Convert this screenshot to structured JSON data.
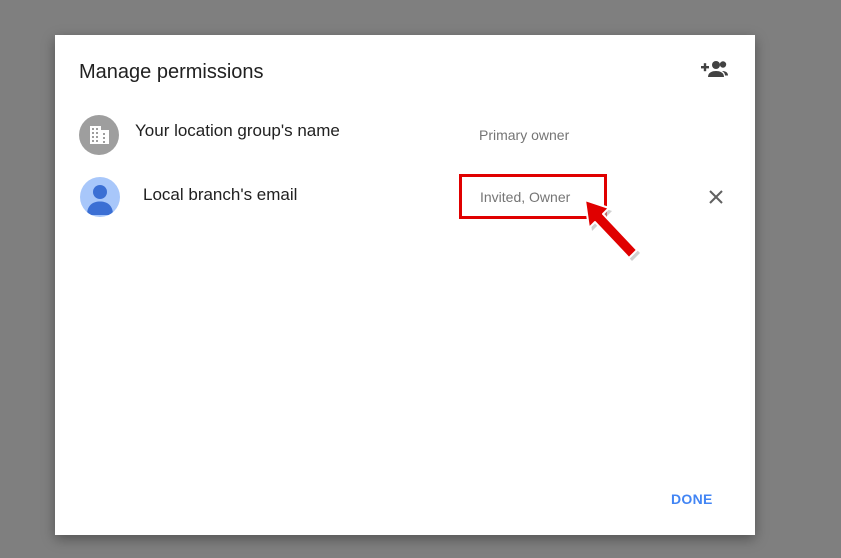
{
  "dialog": {
    "title": "Manage permissions",
    "add_person_icon": "person-add-icon",
    "done_label": "DONE"
  },
  "members": [
    {
      "name": "Your location group's name",
      "role": "Primary owner",
      "avatar_icon": "building-icon",
      "avatar_color": "#9e9e9e"
    },
    {
      "name": "Local branch's email",
      "role": "Invited, Owner",
      "avatar_icon": "person-icon",
      "avatar_color": "#a8c7fa",
      "remove_icon": "close-icon"
    }
  ],
  "colors": {
    "backdrop": "#7f7f7f",
    "accent": "#4285f4",
    "highlight": "#e00000"
  }
}
